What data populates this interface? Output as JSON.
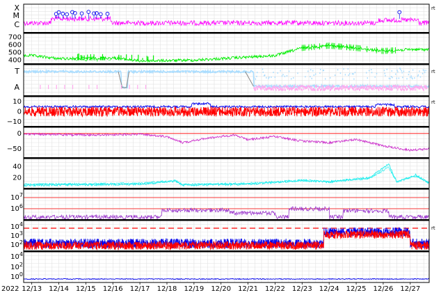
{
  "chart_data": {
    "type": "line",
    "x_start_label": "2022",
    "x_ticks": [
      "12/13",
      "12/14",
      "12/15",
      "12/16",
      "12/17",
      "12/18",
      "12/19",
      "12/20",
      "12/21",
      "12/22",
      "12/23",
      "12/24",
      "12/25",
      "12/26",
      "12/27"
    ],
    "colors": {
      "magenta": "#ff00ff",
      "green": "#00ee00",
      "lightblue": "#aaddff",
      "pink": "#ffaaee",
      "blue": "#0000ee",
      "red": "#ff0000",
      "purple": "#cc33cc",
      "cyan": "#22eeee",
      "dark_purple": "#9933cc",
      "gray": "#888888"
    },
    "panels": [
      {
        "id": "p1",
        "y_ticks": [
          "X",
          "M",
          "C"
        ],
        "right_mark": "rt",
        "series": [
          {
            "color": "magenta",
            "level": "C-to-M"
          }
        ],
        "markers_days": [
          13.9,
          14.0,
          14.15,
          14.3,
          14.5,
          14.6,
          14.85,
          15.1,
          15.3,
          15.4,
          15.55,
          15.8,
          26.6
        ]
      },
      {
        "id": "p2",
        "y_ticks": [
          "700",
          "600",
          "500",
          "400"
        ],
        "ylim": [
          350,
          750
        ],
        "series": [
          {
            "color": "green",
            "approx": [
              [
                13,
                460
              ],
              [
                14,
                420
              ],
              [
                16,
                430
              ],
              [
                17,
                390
              ],
              [
                19,
                400
              ],
              [
                22,
                460
              ],
              [
                23,
                560
              ],
              [
                24,
                590
              ],
              [
                25,
                560
              ],
              [
                26,
                520
              ],
              [
                27,
                540
              ]
            ]
          }
        ]
      },
      {
        "id": "p3",
        "y_ticks": [
          "T",
          "A"
        ],
        "right_mark": "rt",
        "series": [
          {
            "color": "lightblue"
          },
          {
            "color": "pink"
          }
        ]
      },
      {
        "id": "p4",
        "y_ticks": [
          "10",
          "0",
          "−10"
        ],
        "ylim": [
          -15,
          15
        ],
        "right_mark": "rt",
        "series": [
          {
            "color": "blue"
          },
          {
            "color": "red"
          }
        ]
      },
      {
        "id": "p5",
        "y_ticks": [
          "0",
          "−50"
        ],
        "ylim": [
          -80,
          20
        ],
        "series": [
          {
            "color": "purple"
          }
        ]
      },
      {
        "id": "p6",
        "y_ticks": [
          "40",
          "20"
        ],
        "ylim": [
          0,
          55
        ],
        "series": [
          {
            "color": "cyan"
          }
        ]
      },
      {
        "id": "p7",
        "y_ticks": [
          "7",
          "6"
        ],
        "y_tick_base": "10",
        "series": [
          {
            "color": "dark_purple"
          }
        ]
      },
      {
        "id": "p8",
        "y_ticks": [
          "4",
          "3",
          "2"
        ],
        "y_tick_base": "10",
        "right_mark": "rt",
        "series": [
          {
            "color": "blue"
          },
          {
            "color": "red"
          }
        ]
      },
      {
        "id": "p9",
        "y_ticks": [
          "4",
          "2",
          "0"
        ],
        "y_tick_base": "10",
        "series": [
          {
            "color": "blue"
          }
        ]
      }
    ]
  }
}
